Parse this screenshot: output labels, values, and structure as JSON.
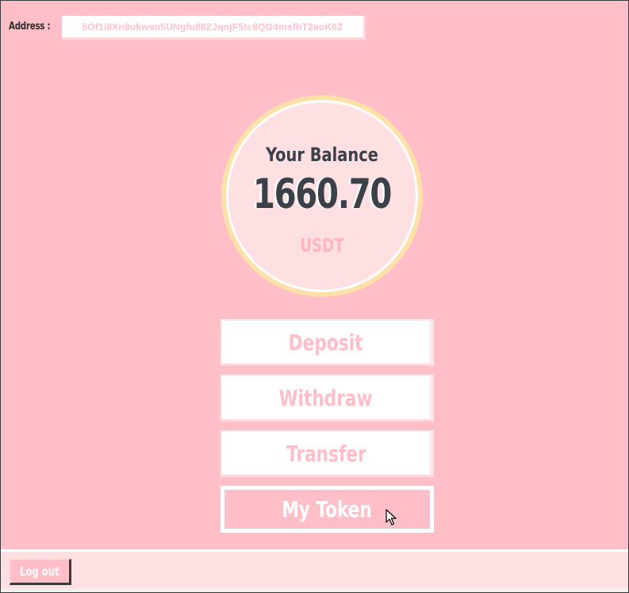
{
  "header": {
    "address_label": "Address :",
    "address_value": "5Of1i8Xn8okwsn5UNgfu88ZJqnjF5tc8QG4msfhT2aoK6Z"
  },
  "balance": {
    "title": "Your Balance",
    "amount": "1660.70",
    "unit": "USDT"
  },
  "actions": {
    "deposit": "Deposit",
    "withdraw": "Withdraw",
    "transfer": "Transfer",
    "my_token": "My Token"
  },
  "footer": {
    "logout": "Log out"
  },
  "icons": {
    "cursor": "mouse-pointer-icon"
  },
  "colors": {
    "background": "#ffbec8",
    "circle_ring": "#ffe0a8",
    "circle_fill": "#ffe0e2",
    "button_text": "#ffbec8",
    "dark_text": "#3c4048"
  }
}
